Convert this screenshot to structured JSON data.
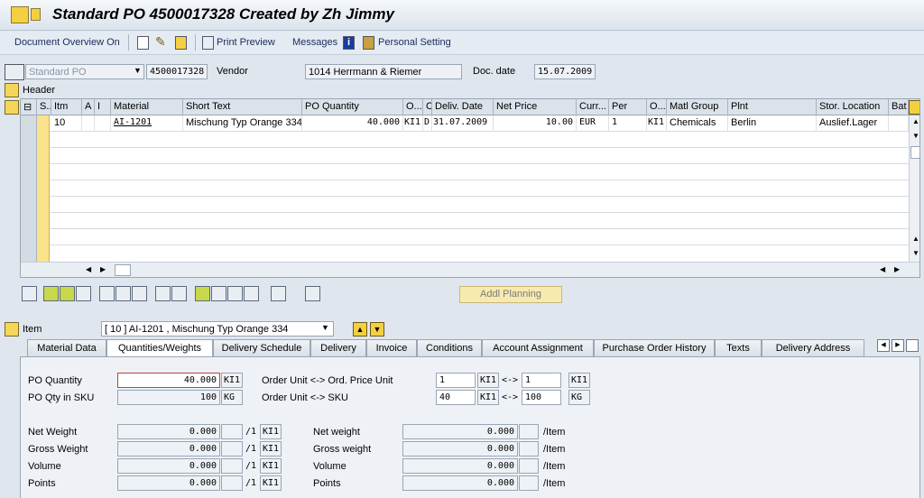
{
  "title": "Standard PO 4500017328 Created by Zh Jimmy",
  "toolbar": {
    "document_overview": "Document Overview On",
    "print_preview": "Print Preview",
    "messages": "Messages",
    "personal_setting": "Personal Setting"
  },
  "header": {
    "po_type": "Standard PO",
    "po_number": "4500017328",
    "vendor_label": "Vendor",
    "vendor_value": "1014 Herrmann & Riemer",
    "doc_date_label": "Doc. date",
    "doc_date_value": "15.07.2009",
    "header_label": "Header"
  },
  "grid": {
    "columns": [
      "S..",
      "Itm",
      "A",
      "I",
      "Material",
      "Short Text",
      "PO Quantity",
      "O...",
      "C",
      "Deliv. Date",
      "Net Price",
      "Curr...",
      "Per",
      "O...",
      "Matl Group",
      "Plnt",
      "Stor. Location",
      "Bat"
    ],
    "row": {
      "itm": "10",
      "material": "AI-1201",
      "short_text": "Mischung Typ Orange 334",
      "po_quantity": "40.000",
      "order_unit": "KI1",
      "c": "D",
      "deliv_date": "31.07.2009",
      "net_price": "10.00",
      "currency": "EUR",
      "per": "1",
      "order_price_unit": "KI1",
      "matl_group": "Chemicals",
      "plant": "Berlin",
      "stor_location": "Auslief.Lager"
    }
  },
  "addl_planning": "Addl Planning",
  "item": {
    "label": "Item",
    "selected": "[ 10 ] AI-1201 , Mischung Typ Orange 334"
  },
  "tabs": [
    "Material Data",
    "Quantities/Weights",
    "Delivery Schedule",
    "Delivery",
    "Invoice",
    "Conditions",
    "Account Assignment",
    "Purchase Order History",
    "Texts",
    "Delivery Address"
  ],
  "qw": {
    "po_quantity_label": "PO Quantity",
    "po_quantity": "40.000",
    "po_quantity_unit": "KI1",
    "po_qty_sku_label": "PO Qty in SKU",
    "po_qty_sku": "100",
    "po_qty_sku_unit": "KG",
    "ou_opu_label": "Order Unit <-> Ord. Price Unit",
    "ou_opu_left": "1",
    "ou_opu_left_unit": "KI1",
    "arrow": "<->",
    "ou_opu_right": "1",
    "ou_opu_right_unit": "KI1",
    "ou_sku_label": "Order Unit <-> SKU",
    "ou_sku_left": "40",
    "ou_sku_left_unit": "KI1",
    "ou_sku_right": "100",
    "ou_sku_right_unit": "KG",
    "left_rows": [
      {
        "label": "Net Weight",
        "value": "0.000",
        "per": "/1",
        "unit": "KI1"
      },
      {
        "label": "Gross Weight",
        "value": "0.000",
        "per": "/1",
        "unit": "KI1"
      },
      {
        "label": "Volume",
        "value": "0.000",
        "per": "/1",
        "unit": "KI1"
      },
      {
        "label": "Points",
        "value": "0.000",
        "per": "/1",
        "unit": "KI1"
      }
    ],
    "right_rows": [
      {
        "label": "Net weight",
        "value": "0.000",
        "per": "/Item"
      },
      {
        "label": "Gross weight",
        "value": "0.000",
        "per": "/Item"
      },
      {
        "label": "Volume",
        "value": "0.000",
        "per": "/Item"
      },
      {
        "label": "Points",
        "value": "0.000",
        "per": "/Item"
      }
    ]
  }
}
